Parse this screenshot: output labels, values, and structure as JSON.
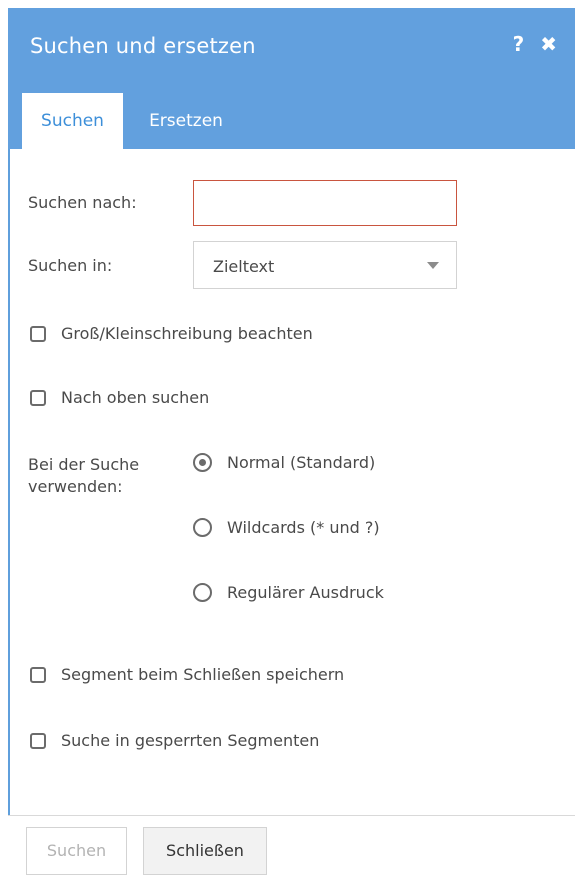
{
  "dialog": {
    "title": "Suchen und ersetzen",
    "help_icon": "question-icon",
    "close_icon": "close-icon",
    "help_glyph": "?",
    "close_glyph": "✖"
  },
  "tabs": [
    {
      "label": "Suchen",
      "active": true
    },
    {
      "label": "Ersetzen",
      "active": false
    }
  ],
  "form": {
    "search_for_label": "Suchen nach:",
    "search_for_value": "",
    "search_in_label": "Suchen in:",
    "search_in_value": "Zieltext",
    "case_sensitive_label": "Groß/Kleinschreibung beachten",
    "case_sensitive_checked": false,
    "search_up_label": "Nach oben suchen",
    "search_up_checked": false,
    "search_mode_label_line1": "Bei der Suche",
    "search_mode_label_line2": "verwenden:",
    "search_modes": [
      {
        "label": "Normal (Standard)",
        "selected": true
      },
      {
        "label": "Wildcards (* und ?)",
        "selected": false
      },
      {
        "label": "Regulärer Ausdruck",
        "selected": false
      }
    ],
    "save_segment_label": "Segment beim Schließen speichern",
    "save_segment_checked": false,
    "search_locked_label": "Suche in gesperrten Segmenten",
    "search_locked_checked": false
  },
  "footer": {
    "search_button": "Suchen",
    "close_button": "Schließen"
  },
  "colors": {
    "header": "#62a0de",
    "active_tab_text": "#3d8fd9",
    "input_error_border": "#c9553f"
  }
}
